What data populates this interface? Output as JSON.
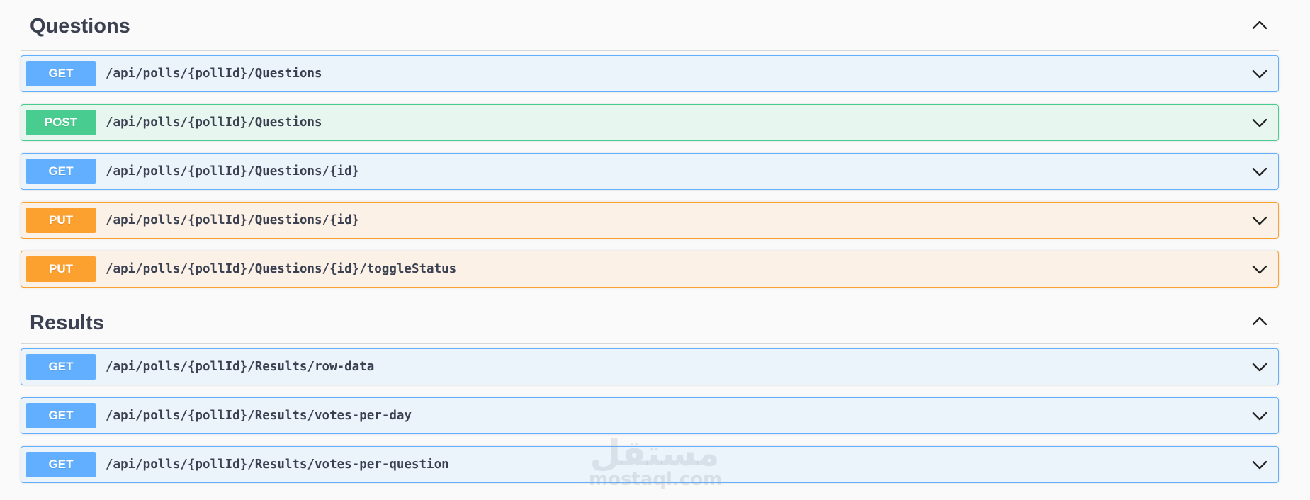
{
  "sections": [
    {
      "title": "Questions",
      "operations": [
        {
          "method": "GET",
          "path": "/api/polls/{pollId}/Questions"
        },
        {
          "method": "POST",
          "path": "/api/polls/{pollId}/Questions"
        },
        {
          "method": "GET",
          "path": "/api/polls/{pollId}/Questions/{id}"
        },
        {
          "method": "PUT",
          "path": "/api/polls/{pollId}/Questions/{id}"
        },
        {
          "method": "PUT",
          "path": "/api/polls/{pollId}/Questions/{id}/toggleStatus"
        }
      ]
    },
    {
      "title": "Results",
      "operations": [
        {
          "method": "GET",
          "path": "/api/polls/{pollId}/Results/row-data"
        },
        {
          "method": "GET",
          "path": "/api/polls/{pollId}/Results/votes-per-day"
        },
        {
          "method": "GET",
          "path": "/api/polls/{pollId}/Results/votes-per-question"
        }
      ]
    }
  ],
  "watermark": {
    "arabic": "مستقل",
    "latin": "mostaql.com"
  },
  "colors": {
    "get": "#61affe",
    "post": "#49cc90",
    "put": "#fca130",
    "text": "#3b4151"
  },
  "icons": {
    "section_toggle": "chevron-up-icon",
    "operation_toggle": "chevron-down-icon"
  }
}
